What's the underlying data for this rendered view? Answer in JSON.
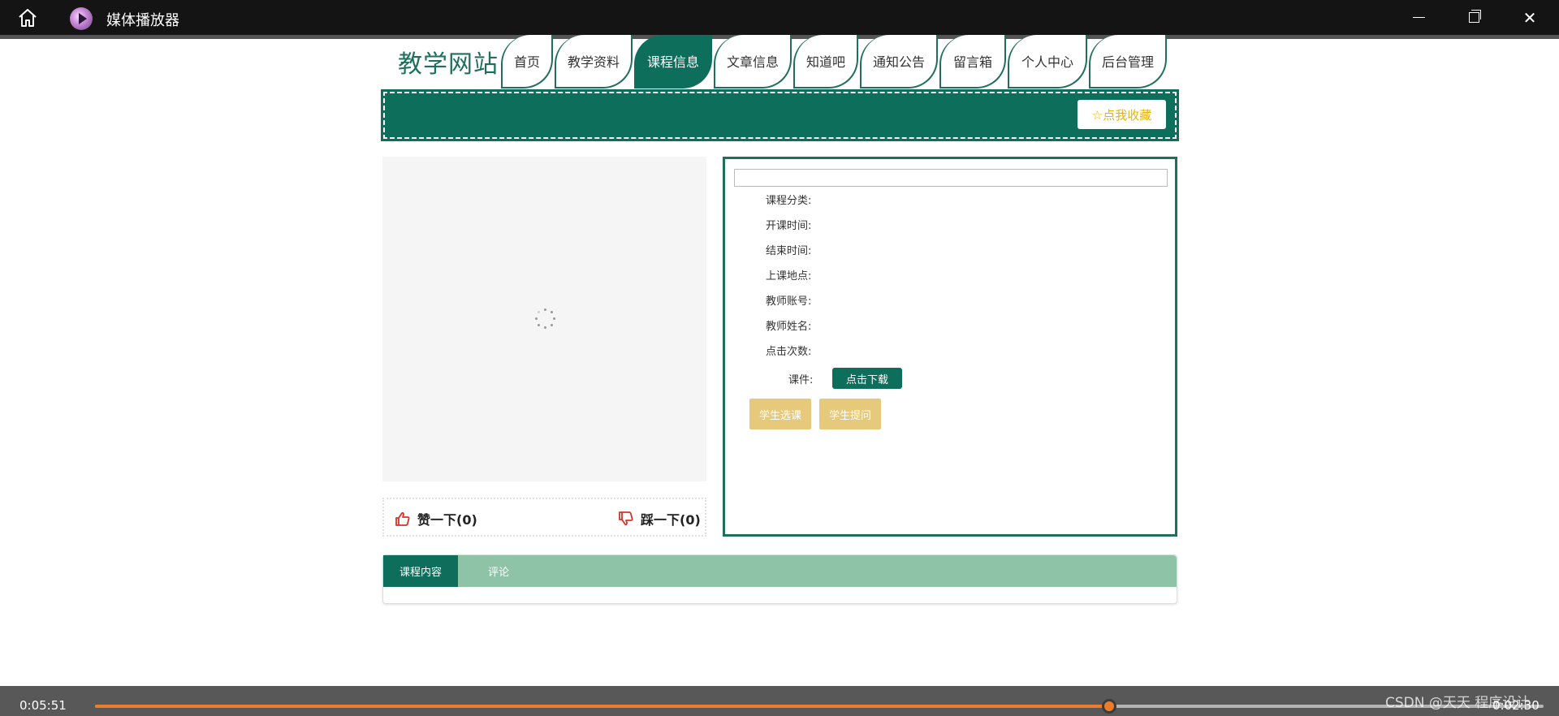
{
  "window": {
    "app_title": "媒体播放器",
    "icons": [
      "home-icon",
      "media-player-icon",
      "minimize-icon",
      "maximize-icon",
      "close-icon"
    ]
  },
  "site": {
    "title": "教学网站",
    "nav": [
      "首页",
      "教学资料",
      "课程信息",
      "文章信息",
      "知道吧",
      "通知公告",
      "留言箱",
      "个人中心",
      "后台管理"
    ],
    "active_nav": "课程信息",
    "favorite_label": "☆点我收藏",
    "accent_color": "#0e6e5c"
  },
  "votes": {
    "like_label": "赞一下(0)",
    "dislike_label": "踩一下(0)"
  },
  "detail": {
    "title_value": "",
    "fields": {
      "category": "课程分类:",
      "start_time": "开课时间:",
      "end_time": "结束时间:",
      "location": "上课地点:",
      "teacher_account": "教师账号:",
      "teacher_name": "教师姓名:",
      "clicks": "点击次数:",
      "courseware": "课件:"
    },
    "download_label": "点击下载",
    "enroll_label": "学生选课",
    "question_label": "学生提问"
  },
  "tabs": [
    "课程内容",
    "评论"
  ],
  "player": {
    "elapsed": "0:05:51",
    "remaining": "0:02:30",
    "progress": 0.7,
    "watermark": "CSDN @天天 程序设计"
  }
}
